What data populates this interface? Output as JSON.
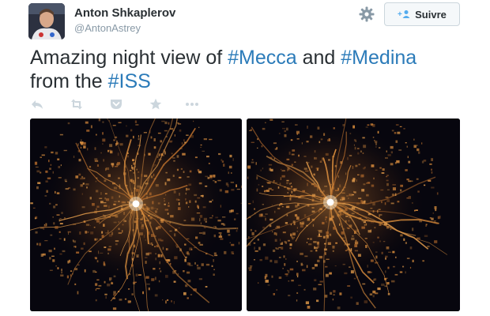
{
  "tweet": {
    "author_name": "Anton Shkaplerov",
    "author_handle": "@AntonAstrey",
    "follow_label": "Suivre",
    "text_1": "Amazing night view of ",
    "tag_mecca": "#Mecca",
    "text_2": " and ",
    "tag_medina": "#Medina",
    "text_3": "from the ",
    "tag_iss": "#ISS"
  },
  "icons": [
    "gear-icon",
    "follow-plus-icon",
    "reply-icon",
    "retweet-icon",
    "pocket-icon",
    "favorite-icon",
    "more-icon"
  ],
  "colors": {
    "text": "#292f33",
    "muted": "#8899a6",
    "hashtag": "#2b7bb9",
    "action_icon": "#ccd6dd",
    "city_light": "#c8823a",
    "photo_background": "#07060e"
  }
}
